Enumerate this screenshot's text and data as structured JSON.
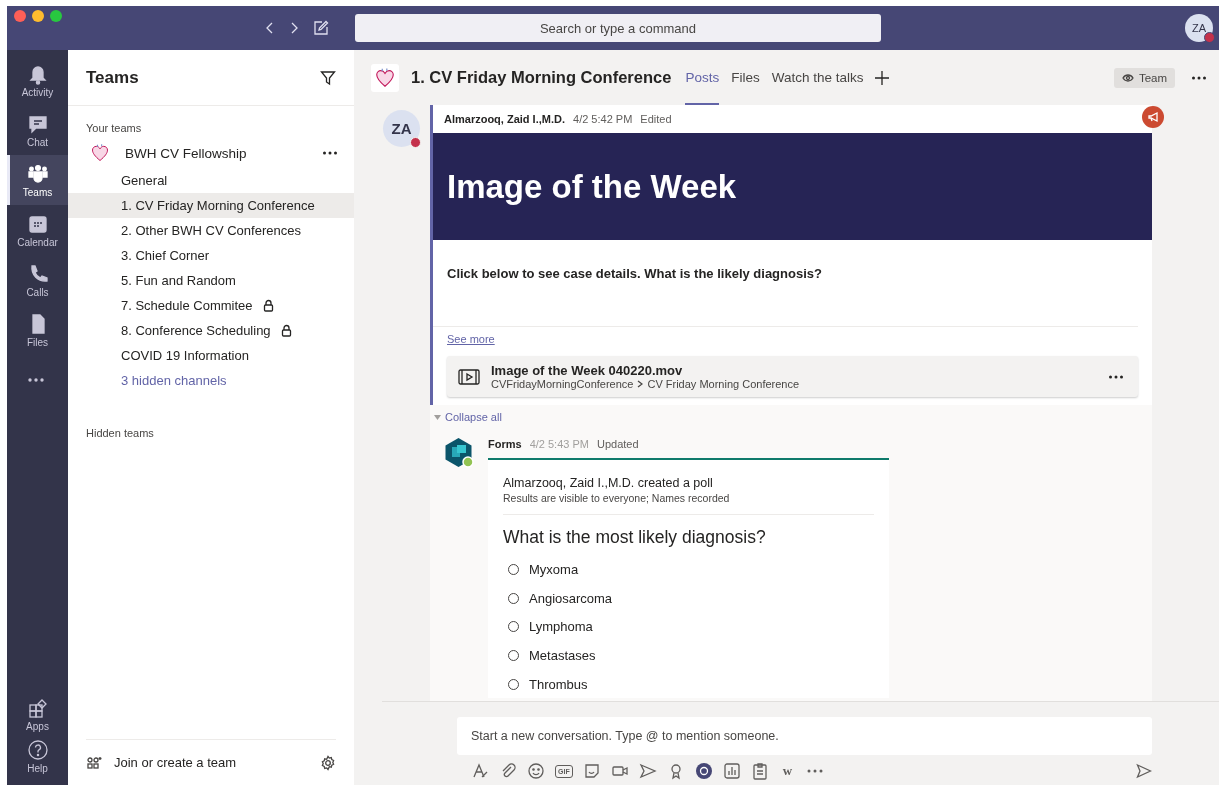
{
  "titlebar": {
    "search_placeholder": "Search or type a command",
    "avatar": {
      "initials": "ZA",
      "busy": true
    }
  },
  "rail": {
    "items": [
      {
        "label": "Activity",
        "kind": "bell",
        "selected": false
      },
      {
        "label": "Chat",
        "kind": "chat",
        "selected": false
      },
      {
        "label": "Teams",
        "kind": "teams",
        "selected": true
      },
      {
        "label": "Calendar",
        "kind": "calendar",
        "selected": false
      },
      {
        "label": "Calls",
        "kind": "phone",
        "selected": false
      },
      {
        "label": "Files",
        "kind": "file",
        "selected": false
      }
    ],
    "bottom": [
      {
        "label": "Apps",
        "kind": "apps"
      },
      {
        "label": "Help",
        "kind": "help"
      }
    ]
  },
  "teams_panel": {
    "title": "Teams",
    "section": "Your teams",
    "team": {
      "name": "BWH CV Fellowship",
      "channels": [
        {
          "name": "General",
          "selected": false,
          "private": false
        },
        {
          "name": "1. CV Friday Morning Conference",
          "selected": true,
          "private": false
        },
        {
          "name": "2. Other BWH CV Conferences",
          "selected": false,
          "private": false
        },
        {
          "name": "3. Chief Corner",
          "selected": false,
          "private": false
        },
        {
          "name": "5. Fun and Random",
          "selected": false,
          "private": false
        },
        {
          "name": "7. Schedule Commitee",
          "selected": false,
          "private": true
        },
        {
          "name": "8. Conference Scheduling",
          "selected": false,
          "private": true
        },
        {
          "name": "COVID 19 Information",
          "selected": false,
          "private": false
        }
      ],
      "hidden_channels": "3 hidden channels"
    },
    "hidden_teams": "Hidden teams",
    "join": "Join or create a team"
  },
  "channel": {
    "title": "1. CV Friday Morning Conference",
    "tabs": [
      {
        "label": "Posts",
        "selected": true
      },
      {
        "label": "Files",
        "selected": false
      },
      {
        "label": "Watch the talks",
        "selected": false
      }
    ],
    "team_button": "Team"
  },
  "post": {
    "initials": "ZA",
    "busy": true,
    "author": "Almarzooq, Zaid I.,M.D.",
    "time": "4/2 5:42 PM",
    "status": "Edited",
    "banner_title": "Image of the Week",
    "body": "Click below to see case details. What is the likely diagnosis?",
    "see_more": "See more",
    "file": {
      "name": "Image of the Week 040220.mov",
      "path": [
        "CVFridayMorningConference",
        "CV Friday Morning Conference"
      ]
    }
  },
  "replies": {
    "collapse": "Collapse all",
    "reply": {
      "author": "Forms",
      "time": "4/2 5:43 PM",
      "status": "Updated",
      "poll": {
        "creator": "Almarzooq, Zaid I.,M.D. created a poll",
        "note": "Results are visible to everyone; Names recorded",
        "question": "What is the most likely diagnosis?",
        "options": [
          {
            "label": "Myxoma",
            "selected": false
          },
          {
            "label": "Angiosarcoma",
            "selected": false
          },
          {
            "label": "Lymphoma",
            "selected": false
          },
          {
            "label": "Metastases",
            "selected": false
          },
          {
            "label": "Thrombus",
            "selected": false
          }
        ]
      }
    }
  },
  "compose": {
    "placeholder": "Start a new conversation. Type @ to mention someone.",
    "tools": [
      {
        "kind": "format"
      },
      {
        "kind": "attach"
      },
      {
        "kind": "emoji"
      },
      {
        "kind": "gif",
        "text": "GIF"
      },
      {
        "kind": "sticker"
      },
      {
        "kind": "meet"
      },
      {
        "kind": "stream"
      },
      {
        "kind": "praise"
      },
      {
        "kind": "app"
      },
      {
        "kind": "chart"
      },
      {
        "kind": "clipboard"
      },
      {
        "kind": "wiki",
        "text": "w"
      },
      {
        "kind": "more"
      }
    ]
  }
}
